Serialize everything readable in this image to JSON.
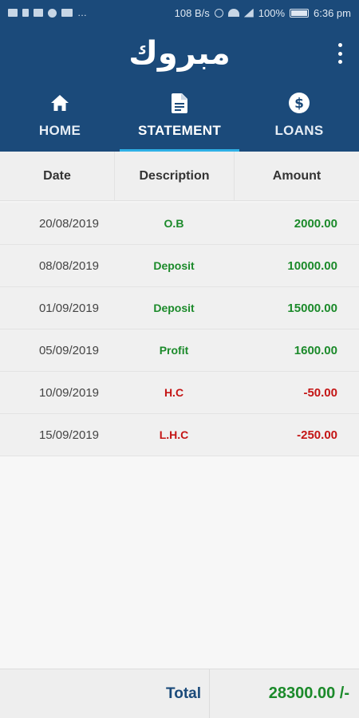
{
  "status_bar": {
    "network_speed": "108 B/s",
    "battery": "100%",
    "time": "6:36 pm",
    "left_text": "…"
  },
  "app": {
    "title": "مبروك"
  },
  "tabs": [
    {
      "label": "HOME",
      "icon": "home-icon",
      "active": false
    },
    {
      "label": "STATEMENT",
      "icon": "document-icon",
      "active": true
    },
    {
      "label": "LOANS",
      "icon": "dollar-icon",
      "active": false
    }
  ],
  "table": {
    "headers": {
      "date": "Date",
      "description": "Description",
      "amount": "Amount"
    },
    "rows": [
      {
        "date": "20/08/2019",
        "description": "O.B",
        "amount": "2000.00",
        "type": "credit"
      },
      {
        "date": "08/08/2019",
        "description": "Deposit",
        "amount": "10000.00",
        "type": "credit"
      },
      {
        "date": "01/09/2019",
        "description": "Deposit",
        "amount": "15000.00",
        "type": "credit"
      },
      {
        "date": "05/09/2019",
        "description": "Profit",
        "amount": "1600.00",
        "type": "credit"
      },
      {
        "date": "10/09/2019",
        "description": "H.C",
        "amount": "-50.00",
        "type": "debit"
      },
      {
        "date": "15/09/2019",
        "description": "L.H.C",
        "amount": "-250.00",
        "type": "debit"
      }
    ]
  },
  "footer": {
    "total_label": "Total",
    "total_value": "28300.00 /-"
  },
  "colors": {
    "header": "#1b4a7a",
    "accent": "#2eb0e6",
    "credit": "#1b8a2a",
    "debit": "#c41515"
  }
}
